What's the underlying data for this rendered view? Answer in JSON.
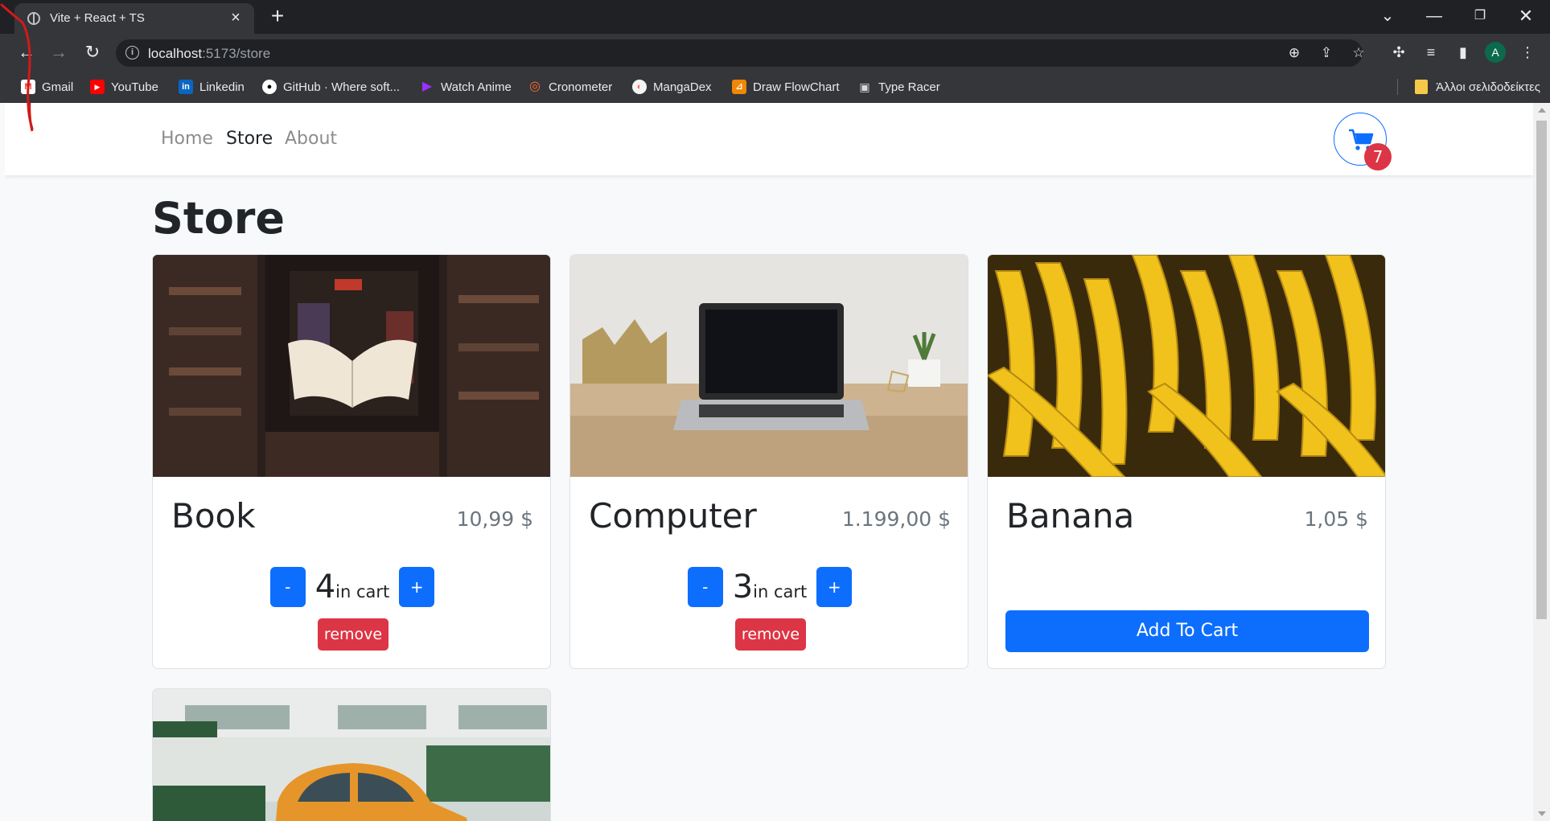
{
  "browser": {
    "tab_title": "Vite + React + TS",
    "url_host": "localhost",
    "url_path": ":5173/store",
    "profile_initial": "A",
    "bookmarks": [
      {
        "label": "Gmail",
        "icon": "gmail-icon"
      },
      {
        "label": "YouTube",
        "icon": "youtube-icon"
      },
      {
        "label": "Linkedin",
        "icon": "linkedin-icon"
      },
      {
        "label": "GitHub · Where soft...",
        "icon": "github-icon"
      },
      {
        "label": "Watch Anime",
        "icon": "play-icon"
      },
      {
        "label": "Cronometer",
        "icon": "cronometer-icon"
      },
      {
        "label": "MangaDex",
        "icon": "mangadex-icon"
      },
      {
        "label": "Draw FlowChart",
        "icon": "drawio-icon"
      },
      {
        "label": "Type Racer",
        "icon": "typeracer-icon"
      }
    ],
    "other_bookmarks": "Άλλοι σελιδοδείκτες"
  },
  "nav": {
    "links": [
      "Home",
      "Store",
      "About"
    ],
    "active": "Store",
    "cart_count": "7"
  },
  "page": {
    "title": "Store"
  },
  "products": [
    {
      "name": "Book",
      "price": "10,99 $",
      "quantity": "4",
      "in_cart_label": "in cart",
      "remove_label": "remove",
      "minus_label": "-",
      "plus_label": "+"
    },
    {
      "name": "Computer",
      "price": "1.199,00 $",
      "quantity": "3",
      "in_cart_label": "in cart",
      "remove_label": "remove",
      "minus_label": "-",
      "plus_label": "+"
    },
    {
      "name": "Banana",
      "price": "1,05 $",
      "add_label": "Add To Cart"
    },
    {
      "name": "Car"
    }
  ],
  "colors": {
    "primary": "#0d6efd",
    "danger": "#dc3545",
    "muted": "#6c757d",
    "text": "#212529"
  }
}
